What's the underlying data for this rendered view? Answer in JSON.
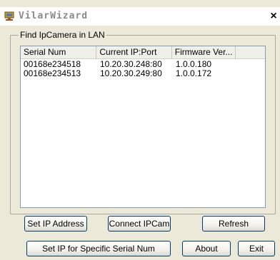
{
  "window": {
    "title": "VilarWizard",
    "close_glyph": "×"
  },
  "group": {
    "legend": "Find IpCamera in LAN"
  },
  "list": {
    "columns": [
      "Serial Num",
      "Current IP:Port",
      "Firmware Ver...",
      ""
    ],
    "rows": [
      [
        "00168e234518",
        "10.20.30.248:80",
        "1.0.0.180"
      ],
      [
        "00168e234513",
        "10.20.30.249:80",
        "1.0.0.172"
      ]
    ]
  },
  "buttons": {
    "set_ip": "Set IP Address",
    "connect": "Connect IPCam",
    "refresh": "Refresh",
    "set_ip_serial": "Set IP for Specific Serial Num",
    "about": "About",
    "exit": "Exit"
  },
  "icons": {
    "app": "app-computer-icon",
    "close": "close-icon"
  },
  "colors": {
    "title_text": "#8b8b8b",
    "button_border": "#003c74",
    "list_border": "#7f9db9"
  }
}
